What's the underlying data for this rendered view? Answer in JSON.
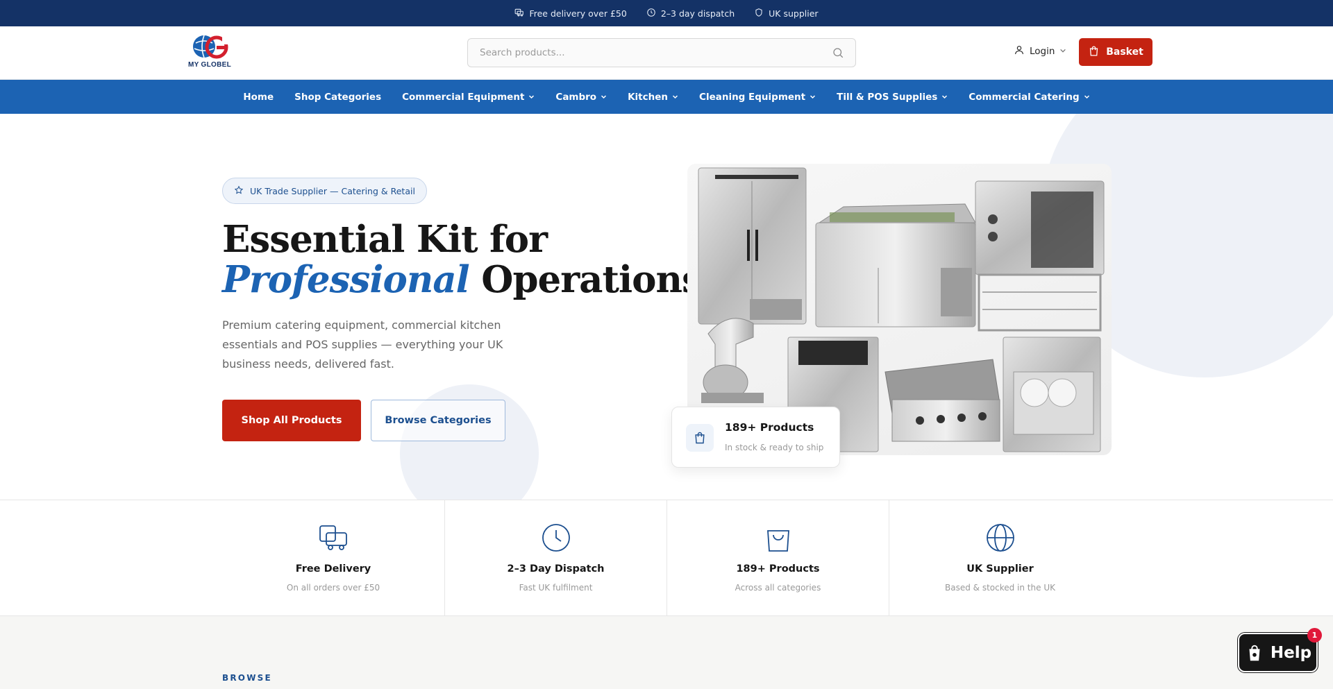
{
  "announcement": {
    "items": [
      {
        "icon": "delivery-icon",
        "text": "Free delivery over £50"
      },
      {
        "icon": "clock-icon",
        "text": "2–3 day dispatch"
      },
      {
        "icon": "shield-icon",
        "text": "UK supplier"
      }
    ]
  },
  "header": {
    "logo_text": "MY GLOBEL",
    "search_placeholder": "Search products...",
    "login_label": "Login",
    "basket_label": "Basket"
  },
  "nav": {
    "items": [
      {
        "label": "Home",
        "dropdown": false
      },
      {
        "label": "Shop Categories",
        "dropdown": false
      },
      {
        "label": "Commercial Equipment",
        "dropdown": true
      },
      {
        "label": "Cambro",
        "dropdown": true
      },
      {
        "label": "Kitchen",
        "dropdown": true
      },
      {
        "label": "Cleaning Equipment",
        "dropdown": true
      },
      {
        "label": "Till & POS Supplies",
        "dropdown": true
      },
      {
        "label": "Commercial Catering",
        "dropdown": true
      }
    ]
  },
  "hero": {
    "badge": "UK Trade Supplier — Catering & Retail",
    "headline_line1": "Essential Kit for",
    "headline_accent": "Professional",
    "headline_rest": " Operations",
    "subcopy": "Premium catering equipment, commercial kitchen essentials and POS supplies — everything your UK business needs, delivered fast.",
    "primary_button": "Shop All Products",
    "secondary_button": "Browse Categories",
    "stat_title": "189+ Products",
    "stat_subtitle": "In stock & ready to ship"
  },
  "features": [
    {
      "icon": "delivery-icon",
      "title": "Free Delivery",
      "subtitle": "On all orders over £50"
    },
    {
      "icon": "clock-icon",
      "title": "2–3 Day Dispatch",
      "subtitle": "Fast UK fulfilment"
    },
    {
      "icon": "shopping-bag-icon",
      "title": "189+ Products",
      "subtitle": "Across all categories"
    },
    {
      "icon": "globe-icon",
      "title": "UK Supplier",
      "subtitle": "Based & stocked in the UK"
    }
  ],
  "browse": {
    "label": "BROWSE"
  },
  "help_widget": {
    "label": "Help",
    "badge_count": "1"
  },
  "colors": {
    "announcement_bg": "#143266",
    "nav_bg": "#1c63b3",
    "primary_red": "#c42311",
    "accent_blue": "#1c63b3"
  }
}
